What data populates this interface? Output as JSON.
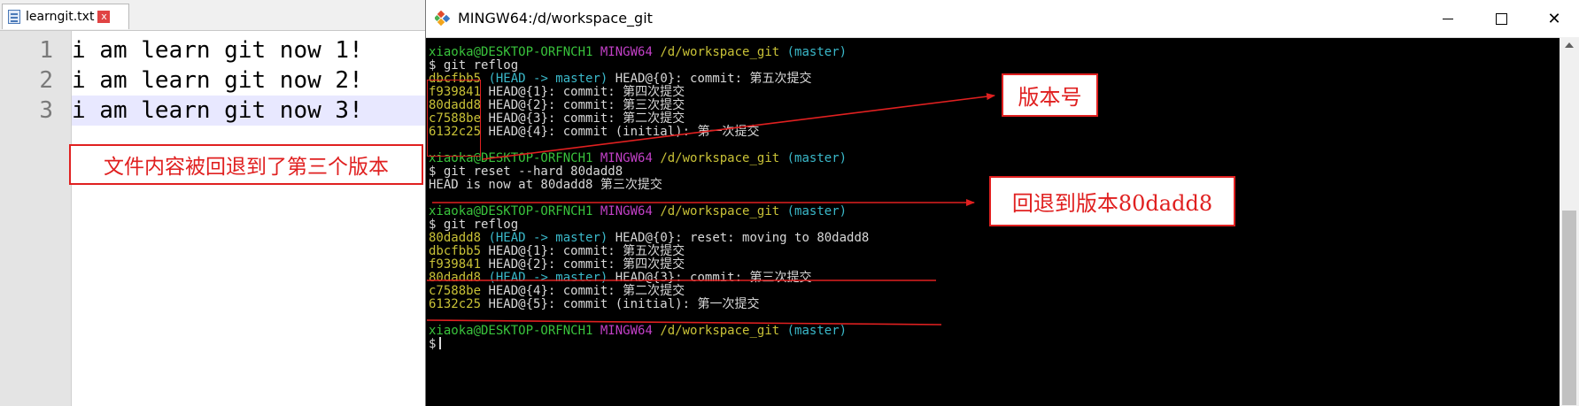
{
  "editor": {
    "tab": {
      "label": "learngit.txt",
      "close": "x"
    },
    "lines": [
      {
        "num": "1",
        "text": "i am learn git now 1!"
      },
      {
        "num": "2",
        "text": "i am learn git now 2!"
      },
      {
        "num": "3",
        "text": "i am learn git now 3!"
      }
    ],
    "note": "文件内容被回退到了第三个版本"
  },
  "terminal": {
    "title": "MINGW64:/d/workspace_git",
    "buttons": {
      "minimize": "minimize",
      "maximize": "maximize",
      "close": "✕"
    },
    "prompt": {
      "user": "xiaoka@DESKTOP-ORFNCH1",
      "env": "MINGW64",
      "path": "/d/workspace_git",
      "branch": "(master)"
    },
    "session": {
      "cmd1": "$ git reflog",
      "reflog1": [
        {
          "hash": "dbcfbb5",
          "head": "(HEAD -> master)",
          "rest": " HEAD@{0}: commit: 第五次提交"
        },
        {
          "hash": "f939841",
          "rest": " HEAD@{1}: commit: 第四次提交"
        },
        {
          "hash": "80dadd8",
          "rest": " HEAD@{2}: commit: 第三次提交"
        },
        {
          "hash": "c7588be",
          "rest": " HEAD@{3}: commit: 第二次提交"
        },
        {
          "hash": "6132c25",
          "rest": " HEAD@{4}: commit (initial): 第一次提交"
        }
      ],
      "cmd2": "$ git reset --hard 80dadd8",
      "out2": "HEAD is now at 80dadd8 第三次提交",
      "cmd3": "$ git reflog",
      "reflog2": [
        {
          "hash": "80dadd8",
          "head": "(HEAD -> master)",
          "rest": " HEAD@{0}: reset: moving to 80dadd8"
        },
        {
          "hash": "dbcfbb5",
          "rest": " HEAD@{1}: commit: 第五次提交"
        },
        {
          "hash": "f939841",
          "rest": " HEAD@{2}: commit: 第四次提交"
        },
        {
          "hash": "80dadd8",
          "head": "(HEAD -> master)",
          "rest": " HEAD@{3}: commit: 第三次提交"
        },
        {
          "hash": "c7588be",
          "rest": " HEAD@{4}: commit: 第二次提交"
        },
        {
          "hash": "6132c25",
          "rest": " HEAD@{5}: commit (initial): 第一次提交"
        }
      ],
      "final_prompt": "$"
    },
    "annotations": {
      "version_label": "版本号",
      "reset_label": "回退到版本80dadd8"
    }
  },
  "colors": {
    "annotation": "#e02020",
    "prompt_user": "#39c33c",
    "prompt_env": "#c240c7",
    "prompt_path": "#c9c237",
    "prompt_branch": "#3ab8c9"
  }
}
